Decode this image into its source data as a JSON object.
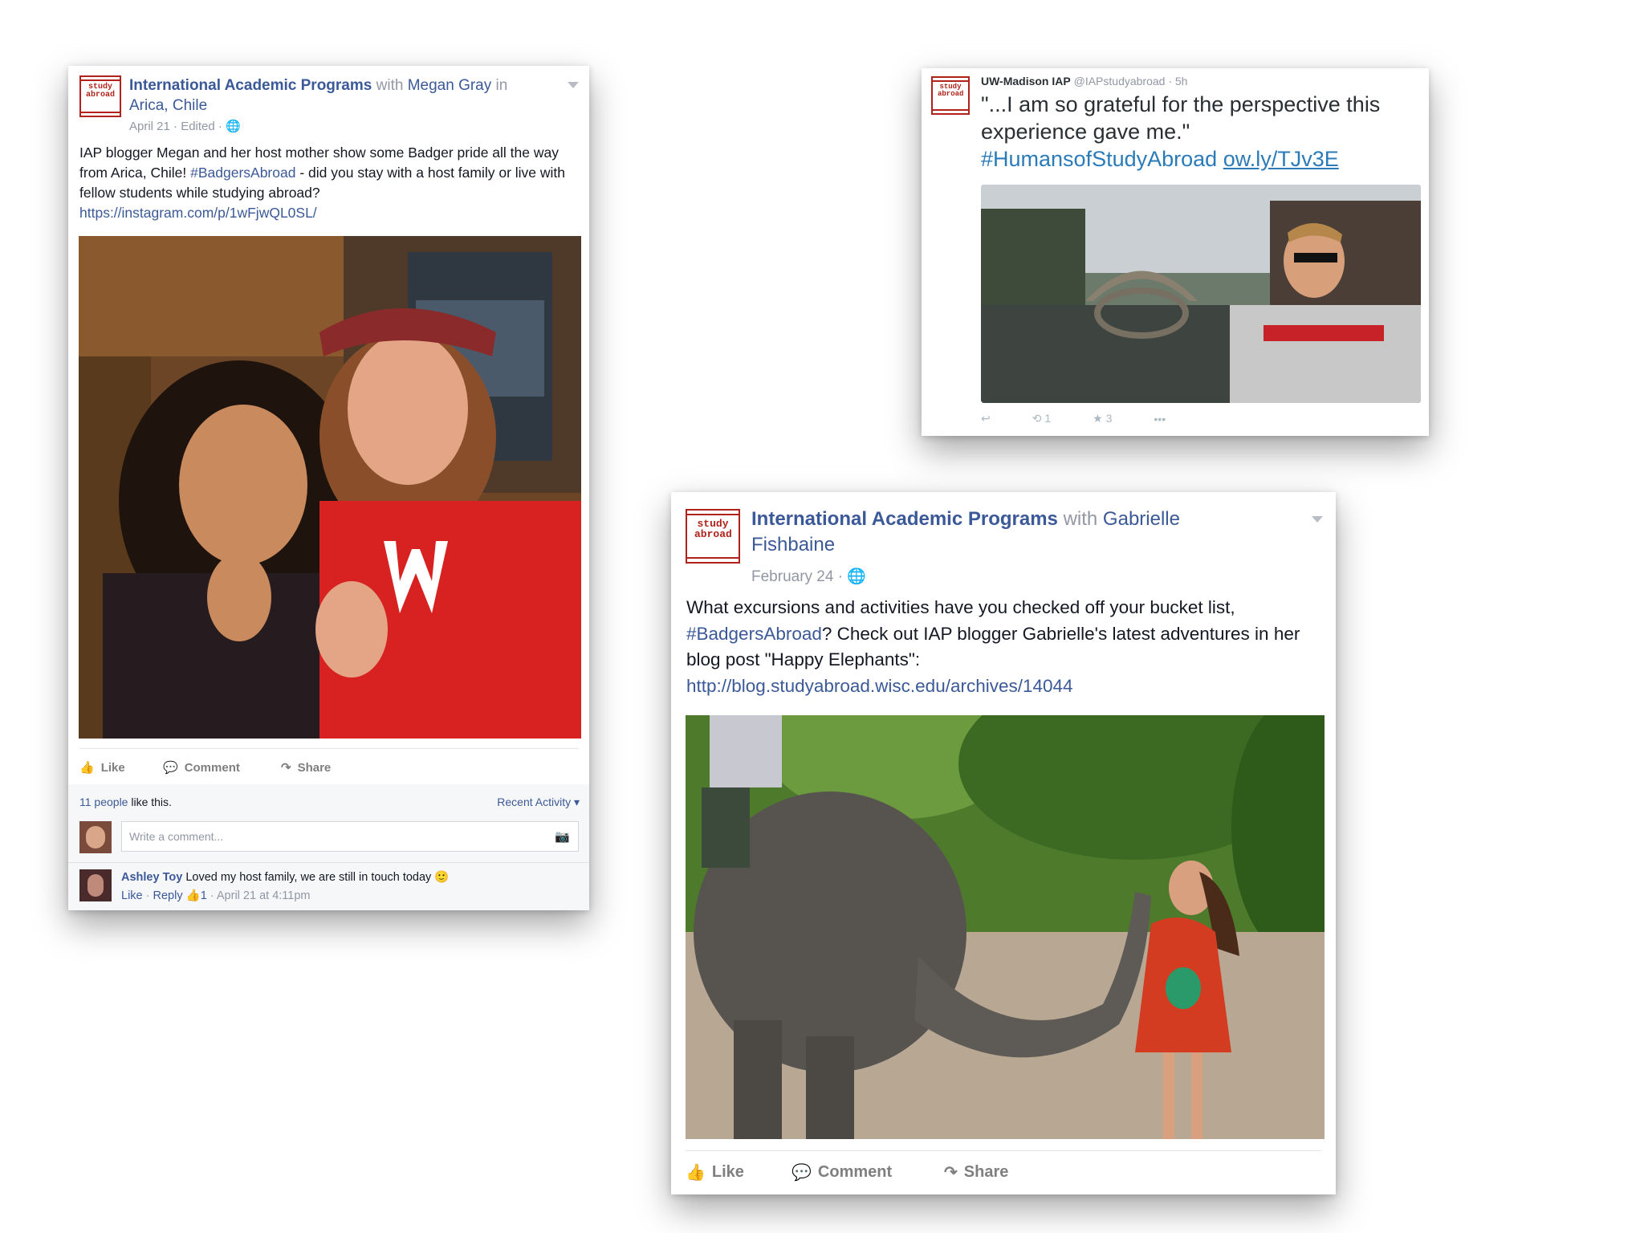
{
  "post1": {
    "logo_text": "study abroad",
    "page_name": "International Academic Programs",
    "with_word": "with",
    "tagged": "Megan Gray",
    "in_word": "in",
    "location": "Arica, Chile",
    "meta": "April 21 · Edited ·",
    "body_text": "IAP blogger Megan and her host mother show some Badger pride all the way from Arica, Chile! ",
    "hashtag": "#BadgersAbroad",
    "body_rest": " - did you stay with a host family or live with fellow students while studying abroad?",
    "link": "https://instagram.com/p/1wFjwQL0SL/",
    "actions": {
      "like": "Like",
      "comment": "Comment",
      "share": "Share"
    },
    "likes_count": "11 people",
    "likes_rest": " like this.",
    "recent_activity": "Recent Activity ▾",
    "comment_placeholder": "Write a comment...",
    "comment": {
      "author": "Ashley Toy",
      "text": "Loved my host family, we are still in touch today",
      "like": "Like",
      "reply": "Reply",
      "likes": "1",
      "time": "April 21 at 4:11pm"
    }
  },
  "tweet": {
    "logo_text": "study abroad",
    "name": "UW-Madison IAP",
    "handle": "@IAPstudyabroad",
    "time": "· 5h",
    "text": "\"...I am so grateful for the perspective this experience gave me.\"",
    "hashtag": "#HumansofStudyAbroad",
    "link": "ow.ly/TJv3E",
    "retweets": "1",
    "favorites": "3"
  },
  "post2": {
    "logo_text": "study abroad",
    "page_name": "International Academic Programs",
    "with_word": "with",
    "tagged_first": "Gabrielle",
    "tagged_last": "Fishbaine",
    "meta": "February 24 ·",
    "body_text": "What excursions and activities have you checked off your bucket list, ",
    "hashtag": "#BadgersAbroad",
    "body_rest": "? Check out IAP blogger Gabrielle's latest adventures in her blog post \"Happy Elephants\":",
    "link": "http://blog.studyabroad.wisc.edu/archives/14044",
    "actions": {
      "like": "Like",
      "comment": "Comment",
      "share": "Share"
    }
  },
  "colors": {
    "facebook_blue": "#3b5998",
    "twitter_blue": "#2b7bb9",
    "badger_red": "#c5050c"
  }
}
